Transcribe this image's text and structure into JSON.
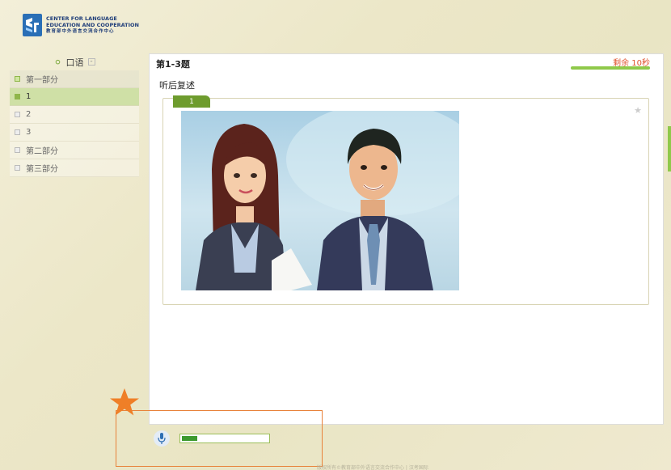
{
  "header": {
    "logo_mark": "CLEC",
    "logo_line1": "CENTER FOR LANGUAGE",
    "logo_line2": "EDUCATION AND COOPERATION",
    "logo_line3": "教育部中外语言交流合作中心"
  },
  "sidebar": {
    "heading": "口语",
    "collapse_symbol": "-",
    "items": [
      {
        "label": "第一部分",
        "type": "section"
      },
      {
        "label": "1",
        "type": "active"
      },
      {
        "label": "2",
        "type": "plain"
      },
      {
        "label": "3",
        "type": "plain"
      },
      {
        "label": "第二部分",
        "type": "plain"
      },
      {
        "label": "第三部分",
        "type": "plain"
      }
    ]
  },
  "main": {
    "title": "第1-3题",
    "timer": "剩余 10秒",
    "timer_progress": 1.0,
    "task": "听后复述",
    "question_tag": "1",
    "star_icon": "★"
  },
  "recorder": {
    "mic_icon": "microphone-icon",
    "volume_level": 0.18
  },
  "footer": {
    "text": "版权所有©教育部中外语言交流合作中心 | 汉考国际"
  },
  "colors": {
    "accent_green": "#6e9c2e",
    "timer_red": "#e0522d",
    "annotation_orange": "#e8823a"
  }
}
